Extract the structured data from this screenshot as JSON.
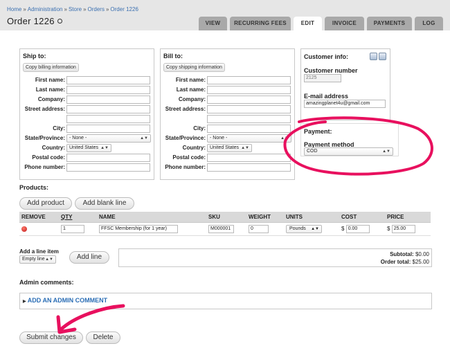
{
  "breadcrumb": [
    "Home",
    "Administration",
    "Store",
    "Orders",
    "Order 1226"
  ],
  "page_title": "Order 1226",
  "tabs": [
    "VIEW",
    "RECURRING FEES",
    "EDIT",
    "INVOICE",
    "PAYMENTS",
    "LOG"
  ],
  "active_tab": "EDIT",
  "ship_to": {
    "title": "Ship to:",
    "copy_button": "Copy billing information",
    "labels": {
      "first_name": "First name:",
      "last_name": "Last name:",
      "company": "Company:",
      "street": "Street address:",
      "city": "City:",
      "state": "State/Province:",
      "country": "Country:",
      "postal": "Postal code:",
      "phone": "Phone number:"
    },
    "state_value": "- None -",
    "country_value": "United States"
  },
  "bill_to": {
    "title": "Bill to:",
    "copy_button": "Copy shipping information",
    "labels": {
      "first_name": "First name:",
      "last_name": "Last name:",
      "company": "Company:",
      "street": "Street address:",
      "city": "City:",
      "state": "State/Province:",
      "country": "Country:",
      "postal": "Postal code:",
      "phone": "Phone number:"
    },
    "state_value": "- None -",
    "country_value": "United States"
  },
  "customer_info": {
    "title": "Customer info:",
    "number_label": "Customer number",
    "number_value": "2125",
    "email_label": "E-mail address",
    "email_value": "amazingplanet4u@gmail.com"
  },
  "payment": {
    "title": "Payment:",
    "method_label": "Payment method",
    "method_value": "COD"
  },
  "products": {
    "title": "Products:",
    "add_product": "Add product",
    "add_blank": "Add blank line",
    "columns": [
      "REMOVE",
      "QTY",
      "NAME",
      "SKU",
      "WEIGHT",
      "UNITS",
      "COST",
      "PRICE"
    ],
    "rows": [
      {
        "qty": "1",
        "name": "FFSC Membership (for 1 year)",
        "sku": "M000001",
        "weight": "0",
        "units": "Pounds",
        "cost_symbol": "$",
        "cost": "0.00",
        "price_symbol": "$",
        "price": "25.00"
      }
    ]
  },
  "line_item": {
    "label": "Add a line item",
    "select_value": "Empty line",
    "button": "Add line"
  },
  "totals": {
    "subtotal_label": "Subtotal:",
    "subtotal_value": "$0.00",
    "order_total_label": "Order total:",
    "order_total_value": "$25.00"
  },
  "admin": {
    "title": "Admin comments:",
    "add_comment": "ADD AN ADMIN COMMENT"
  },
  "actions": {
    "submit": "Submit changes",
    "delete": "Delete"
  },
  "colors": {
    "link": "#2a6db5",
    "annotation": "#e8105e",
    "tab_inactive": "#a9a9a9"
  }
}
